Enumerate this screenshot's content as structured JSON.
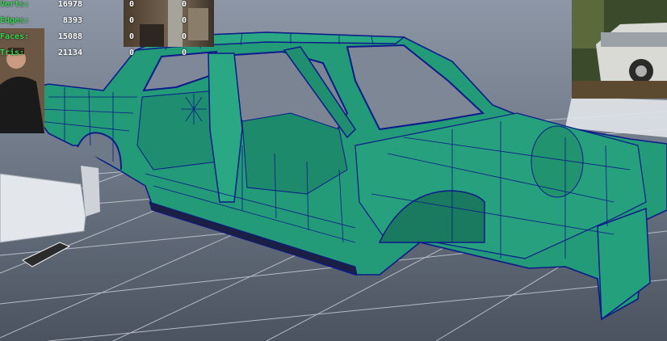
{
  "viewport": {
    "name": "3D modeling viewport"
  },
  "hud_stats": [
    {
      "label": "Verts:",
      "value": "16978",
      "selected": "0",
      "extra": "0"
    },
    {
      "label": "Edges:",
      "value": "8393",
      "selected": "0",
      "extra": "0"
    },
    {
      "label": "Faces:",
      "value": "15088",
      "selected": "0",
      "extra": "0"
    },
    {
      "label": "Tris:",
      "value": "21134",
      "selected": "0",
      "extra": "0"
    }
  ],
  "colors": {
    "mesh_face": "#239a78",
    "mesh_wire": "#0c1a8a",
    "grid_line": "#c6ccd5",
    "hud_label": "#37d64e",
    "hud_value": "#ffffff"
  }
}
